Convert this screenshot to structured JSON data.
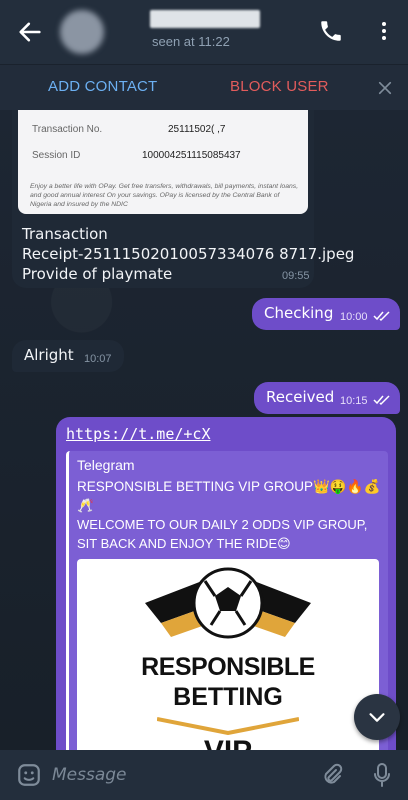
{
  "header": {
    "last_seen": "seen at 11:22"
  },
  "action_bar": {
    "add_contact": "ADD CONTACT",
    "block_user": "BLOCK USER"
  },
  "receipt": {
    "rows": [
      {
        "label": "Transaction No.",
        "value": "25111502(                    ,7"
      },
      {
        "label": "Session ID",
        "value": "100004251115085437"
      }
    ],
    "footer": "Enjoy a better life with OPay. Get free transfers, withdrawals, bill payments, instant loans, and good annual interest On your savings. OPay is licensed by the Central Bank of Nigeria and insured by the NDIC",
    "file_lines": [
      "Transaction",
      "Receipt-25111502010057334076 8717.jpeg",
      "Provide of playmate"
    ],
    "time": "09:55"
  },
  "messages": [
    {
      "text": "Checking",
      "time": "10:00",
      "direction": "out"
    },
    {
      "text": "Alright",
      "time": "10:07",
      "direction": "in"
    },
    {
      "text": "Received",
      "time": "10:15",
      "direction": "out"
    }
  ],
  "link_message": {
    "url": "https://t.me/+cX",
    "site": "Telegram",
    "title": "RESPONSIBLE BETTING VIP GROUP👑🤑🔥💰🥂",
    "description": "WELCOME TO OUR DAILY 2 ODDS VIP GROUP, SIT BACK AND ENJOY THE RIDE😊",
    "logo_lines": [
      "RESPONSIBLE",
      "BETTING",
      "VIP"
    ]
  },
  "composer": {
    "placeholder": "Message"
  },
  "colors": {
    "outgoing_bubble": "#6e4dc9",
    "incoming_bubble": "#1f2936",
    "accent_blue": "#6cb0f2",
    "danger_red": "#e25c5c"
  }
}
